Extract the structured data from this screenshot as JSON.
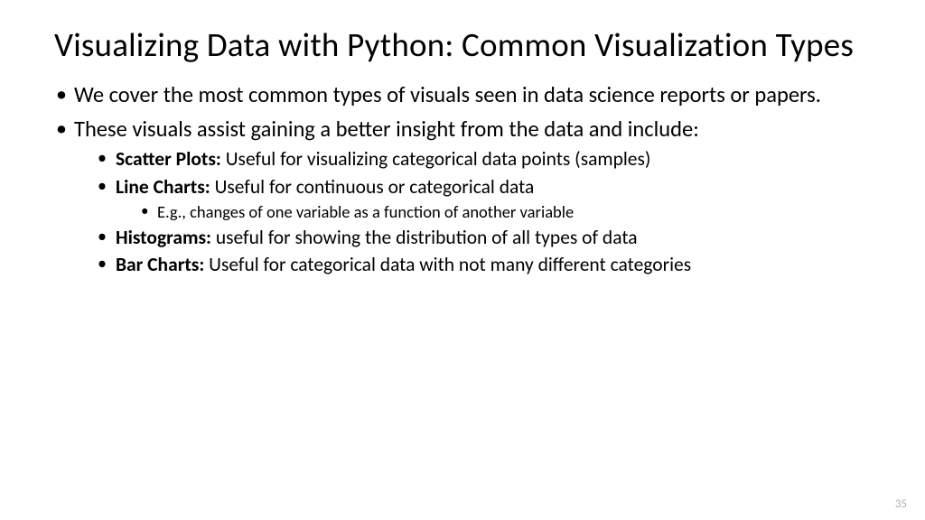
{
  "title": "Visualizing Data with Python: Common Visualization Types",
  "bullets": {
    "b1": "We cover the most common types of visuals seen in data science reports or papers.",
    "b2": "These visuals assist gaining a better insight from the data and include:",
    "sub": {
      "scatter_label": "Scatter Plots: ",
      "scatter_text": "Useful for visualizing categorical data points (samples)",
      "line_label": "Line Charts: ",
      "line_text": "Useful for continuous or categorical data",
      "line_sub": "E.g., changes of one variable as a function of another variable",
      "hist_label": "Histograms: ",
      "hist_text": "useful for showing the distribution of all types of data",
      "bar_label": "Bar Charts: ",
      "bar_text": "Useful for categorical data with not many different categories"
    }
  },
  "page_number": "35"
}
